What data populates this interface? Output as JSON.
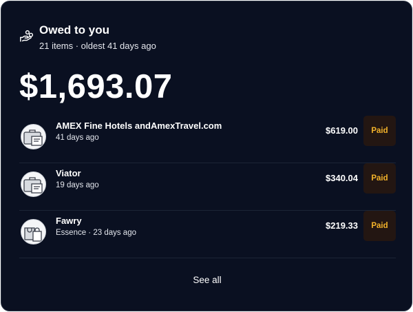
{
  "header": {
    "title": "Owed to you",
    "subtitle": "21 items · oldest 41 days ago",
    "icon": "hand-coins-icon"
  },
  "total": "$1,693.07",
  "items": [
    {
      "name": "AMEX Fine Hotels andAmexTravel.com",
      "meta": "41 days ago",
      "amount": "$619.00",
      "status": "Paid",
      "icon": "briefcase-receipt-icon"
    },
    {
      "name": "Viator",
      "meta": "19 days ago",
      "amount": "$340.04",
      "status": "Paid",
      "icon": "briefcase-receipt-icon"
    },
    {
      "name": "Fawry",
      "meta": "Essence  · 23 days ago",
      "amount": "$219.33",
      "status": "Paid",
      "icon": "shopping-bags-icon"
    }
  ],
  "footer": {
    "see_all_label": "See all"
  },
  "colors": {
    "background": "#0a1021",
    "badge_background": "#231612",
    "badge_text": "#f3b22a",
    "divider": "#1c2536"
  }
}
